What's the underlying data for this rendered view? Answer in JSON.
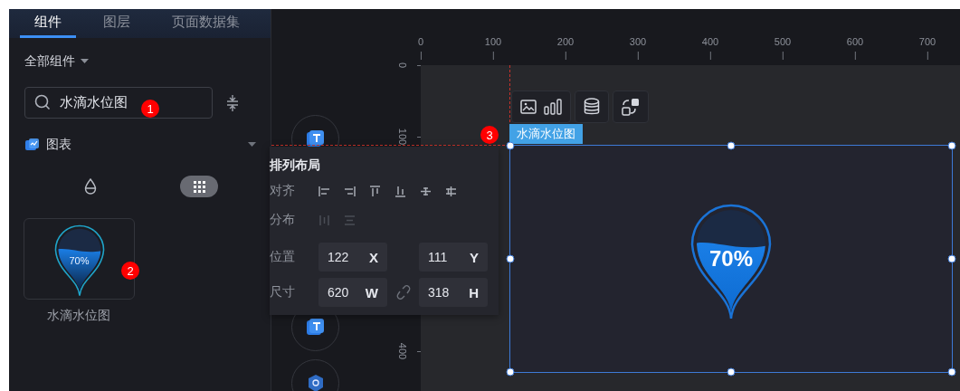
{
  "sidebar": {
    "tabs": [
      {
        "label": "组件",
        "selected": true
      },
      {
        "label": "图层",
        "selected": false
      },
      {
        "label": "页面数据集",
        "selected": false
      }
    ],
    "category_dropdown": "全部组件",
    "search": {
      "value": "水滴水位图"
    },
    "group": {
      "label": "图表",
      "expanded": true
    },
    "view_toggle": [
      {
        "kind": "drop",
        "selected": false
      },
      {
        "kind": "grid",
        "selected": true
      }
    ],
    "components": [
      {
        "label": "水滴水位图",
        "preview_value": "70%",
        "level": 0.7
      }
    ]
  },
  "callouts": [
    "1",
    "2",
    "3"
  ],
  "rulers": {
    "x_ticks": [
      "0",
      "100",
      "200",
      "300",
      "400",
      "500",
      "600",
      "700"
    ],
    "y_ticks": [
      "0",
      "100",
      "400"
    ]
  },
  "layout_panel": {
    "title": "排列布局",
    "align_label": "对齐",
    "distribute_label": "分布",
    "rows": [
      {
        "label": "位置",
        "a_value": "122",
        "a_unit": "X",
        "b_value": "111",
        "b_unit": "Y",
        "linked": false
      },
      {
        "label": "尺寸",
        "a_value": "620",
        "a_unit": "W",
        "b_value": "318",
        "b_unit": "H",
        "linked": true
      }
    ]
  },
  "widget": {
    "name_tag": "水滴水位图",
    "value_label": "70%",
    "level": 0.7
  }
}
